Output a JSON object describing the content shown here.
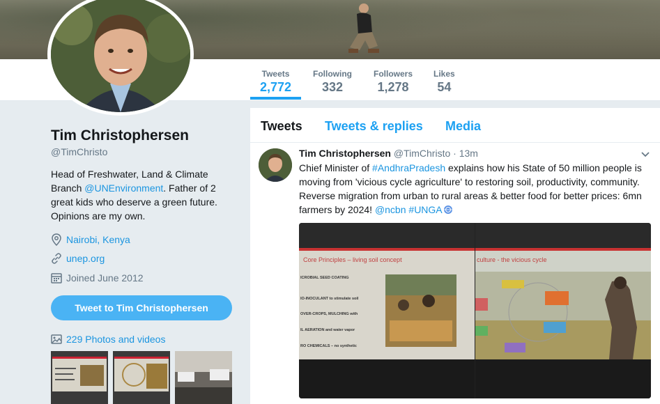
{
  "profile": {
    "name": "Tim Christophersen",
    "handle": "@TimChristo",
    "bio_pre": "Head of Freshwater, Land & Climate Branch ",
    "bio_mention": "@UNEnvironment",
    "bio_post": ". Father of 2 great kids who deserve a green future. Opinions are my own.",
    "location": "Nairobi, Kenya",
    "website": "unep.org",
    "joined": "Joined June 2012",
    "tweet_to_label": "Tweet to Tim Christophersen",
    "photos_label": "229 Photos and videos"
  },
  "stats": [
    {
      "label": "Tweets",
      "value": "2,772"
    },
    {
      "label": "Following",
      "value": "332"
    },
    {
      "label": "Followers",
      "value": "1,278"
    },
    {
      "label": "Likes",
      "value": "54"
    }
  ],
  "tabs": [
    "Tweets",
    "Tweets & replies",
    "Media"
  ],
  "tweet": {
    "author": "Tim Christophersen",
    "handle": "@TimChristo",
    "time": "· 13m",
    "text_1": "Chief Minister of ",
    "hashtag_1": "#AndhraPradesh",
    "text_2": "  explains how his State of 50 million people is moving from 'vicious cycle agriculture' to restoring soil, productivity, community. Reverse migration from urban to rural areas & better food for better prices: 6mn farmers by 2024! ",
    "mention": "@ncbn",
    "hashtag_2": " #UNGA",
    "slide_left_title": "Core Principles – living soil concept",
    "slide_left_items": [
      "ICROBIAL SEED COATING",
      "IO-INOCULANT to stimulate soil",
      "OVER-CROPS, MULCHING with",
      "IL AERATION and water vapor",
      "RO CHEMICALS – no synthetic"
    ],
    "slide_right_title": "culture - the vicious cycle"
  },
  "colors": {
    "accent": "#1da1f2",
    "link": "#1b95e0",
    "muted": "#657786",
    "text": "#14171a",
    "button": "#4ab3f4"
  }
}
